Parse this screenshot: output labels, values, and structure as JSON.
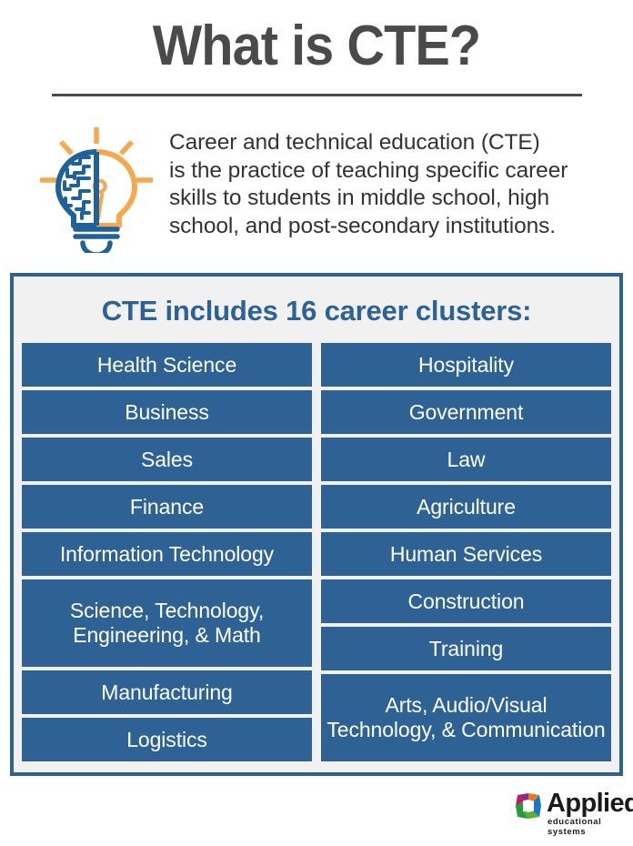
{
  "page": {
    "title": "What is CTE?",
    "background_color": "#ffffff",
    "title_color": "#4a4a4a",
    "accent_blue": "#2f6294",
    "accent_orange": "#f5a94e",
    "panel_fill": "#f1f1f1"
  },
  "intro": {
    "icon": "lightbulb-brain-icon",
    "lines": [
      "Career and technical education (CTE)",
      "is the practice of teaching specific career",
      "skills to students in middle school, high",
      "school, and post-secondary institutions."
    ]
  },
  "clusters_panel": {
    "heading": "CTE includes 16 career clusters:",
    "left_column": [
      {
        "label": "Health Science",
        "lines": [
          "Health Science"
        ],
        "size": "h1x"
      },
      {
        "label": "Business",
        "lines": [
          "Business"
        ],
        "size": "h1x"
      },
      {
        "label": "Sales",
        "lines": [
          "Sales"
        ],
        "size": "h1x"
      },
      {
        "label": "Finance",
        "lines": [
          "Finance"
        ],
        "size": "h1x"
      },
      {
        "label": "Information Technology",
        "lines": [
          "Information Technology"
        ],
        "size": "h1x"
      },
      {
        "label": "Science, Technology, Engineering, & Math",
        "lines": [
          "Science, Technology,",
          "Engineering, & Math"
        ],
        "size": "h2x"
      },
      {
        "label": "Manufacturing",
        "lines": [
          "Manufacturing"
        ],
        "size": "h1x"
      },
      {
        "label": "Logistics",
        "lines": [
          "Logistics"
        ],
        "size": "h1x"
      }
    ],
    "right_column": [
      {
        "label": "Hospitality",
        "lines": [
          "Hospitality"
        ],
        "size": "h1x"
      },
      {
        "label": "Government",
        "lines": [
          "Government"
        ],
        "size": "h1x"
      },
      {
        "label": "Law",
        "lines": [
          "Law"
        ],
        "size": "h1x"
      },
      {
        "label": "Agriculture",
        "lines": [
          "Agriculture"
        ],
        "size": "h1x"
      },
      {
        "label": "Human Services",
        "lines": [
          "Human Services"
        ],
        "size": "h1x"
      },
      {
        "label": "Construction",
        "lines": [
          "Construction"
        ],
        "size": "h1x"
      },
      {
        "label": "Training",
        "lines": [
          "Training"
        ],
        "size": "h1x"
      },
      {
        "label": "Arts, Audio/Visual Technology, & Communication",
        "lines": [
          "Arts, Audio/Visual",
          "Technology, & Communication"
        ],
        "size": "h2x"
      }
    ]
  },
  "logo": {
    "mark": "applied-pinwheel-icon",
    "word": "Applied",
    "sub": "educational systems",
    "mark_colors": {
      "top_left": "#8e2b8a",
      "top_right": "#e8791f",
      "bottom_left": "#1f9c3c",
      "bottom_right": "#1877c4",
      "left_wedge": "#c3185e",
      "bottom_wedge": "#5bb030"
    }
  }
}
